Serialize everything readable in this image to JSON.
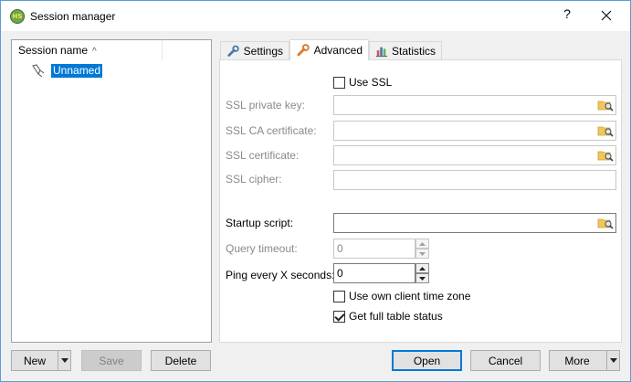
{
  "window": {
    "title": "Session manager",
    "app_icon_text": "HS",
    "help_glyph": "?",
    "close_icon": "close-icon"
  },
  "tree": {
    "column_header": "Session name",
    "sort_icon": "sort-ascending-icon",
    "nodes": [
      {
        "label": "Unnamed",
        "icon": "session-plug-icon",
        "selected": true
      }
    ]
  },
  "tabs": [
    {
      "label": "Settings",
      "icon": "wrench-icon",
      "active": false
    },
    {
      "label": "Advanced",
      "icon": "wrench-orange-icon",
      "active": true
    },
    {
      "label": "Statistics",
      "icon": "bar-chart-icon",
      "active": false
    }
  ],
  "advanced": {
    "use_ssl": {
      "label": "Use SSL",
      "checked": false
    },
    "ssl_private_key": {
      "label": "SSL private key:",
      "value": "",
      "enabled": false
    },
    "ssl_ca_certificate": {
      "label": "SSL CA certificate:",
      "value": "",
      "enabled": false
    },
    "ssl_certificate": {
      "label": "SSL certificate:",
      "value": "",
      "enabled": false
    },
    "ssl_cipher": {
      "label": "SSL cipher:",
      "value": "",
      "enabled": false
    },
    "startup_script": {
      "label": "Startup script:",
      "value": "",
      "enabled": true
    },
    "query_timeout": {
      "label": "Query timeout:",
      "value": "0",
      "enabled": false
    },
    "ping_every": {
      "label": "Ping every X seconds:",
      "value": "0",
      "enabled": true
    },
    "use_own_timezone": {
      "label": "Use own client time zone",
      "checked": false
    },
    "full_table_status": {
      "label": "Get full table status",
      "checked": true
    }
  },
  "buttons": {
    "new": "New",
    "save": "Save",
    "delete": "Delete",
    "open": "Open",
    "cancel": "Cancel",
    "more": "More"
  },
  "colors": {
    "selection": "#0078d7",
    "default_button_border": "#0078d7",
    "disabled_text": "#8a8a8a"
  }
}
